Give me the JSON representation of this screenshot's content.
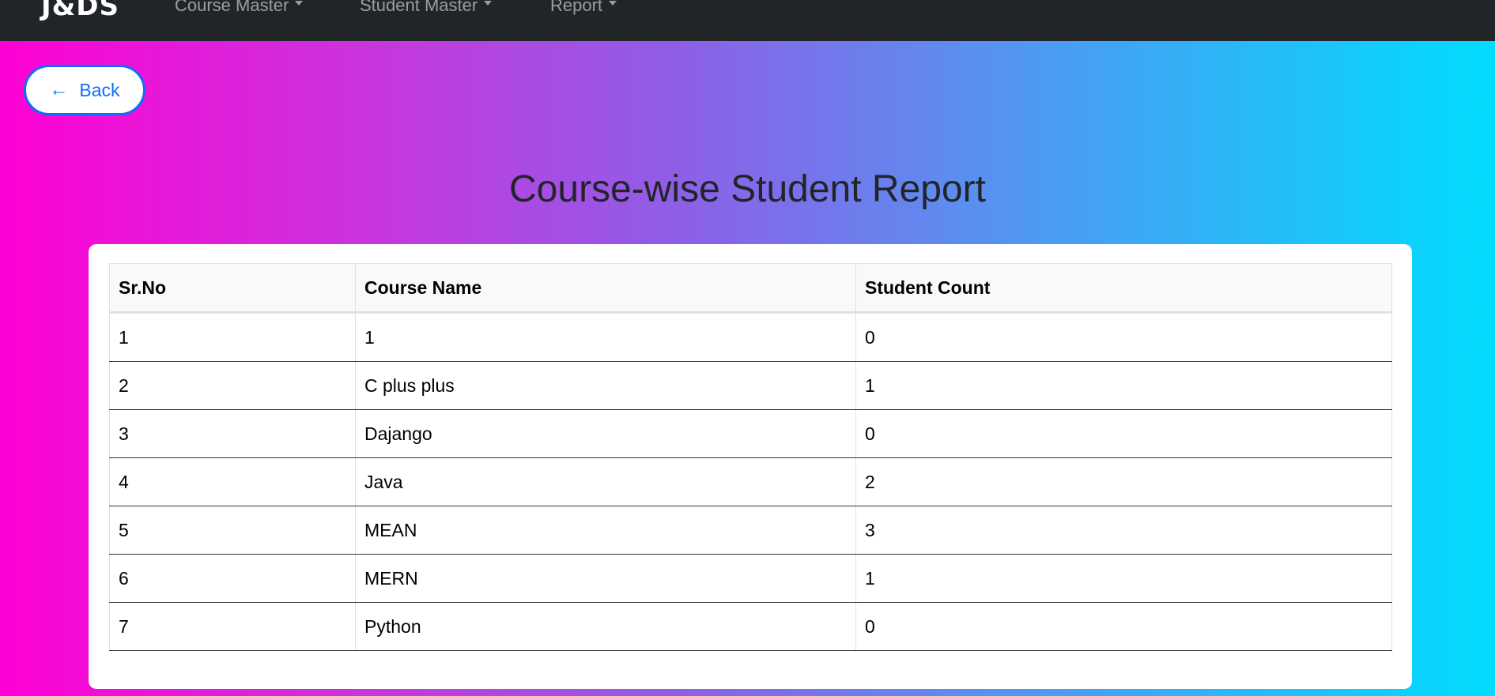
{
  "navbar": {
    "brand": "J&DS",
    "items": [
      {
        "label": "Course Master"
      },
      {
        "label": "Student Master"
      },
      {
        "label": "Report"
      }
    ]
  },
  "back_button": {
    "icon": "left-arrow-icon",
    "arrow": "←",
    "label": "Back"
  },
  "page_title": "Course-wise Student Report",
  "table": {
    "headers": [
      "Sr.No",
      "Course Name",
      "Student Count"
    ],
    "rows": [
      [
        "1",
        "1",
        "0"
      ],
      [
        "2",
        "C plus plus",
        "1"
      ],
      [
        "3",
        "Dajango",
        "0"
      ],
      [
        "4",
        "Java",
        "2"
      ],
      [
        "5",
        "MEAN",
        "3"
      ],
      [
        "6",
        "MERN",
        "1"
      ],
      [
        "7",
        "Python",
        "0"
      ]
    ]
  },
  "colors": {
    "navbar_bg": "#212529",
    "accent": "#0d6efd",
    "gradient_start": "#ff00d4",
    "gradient_end": "#00ddff"
  }
}
